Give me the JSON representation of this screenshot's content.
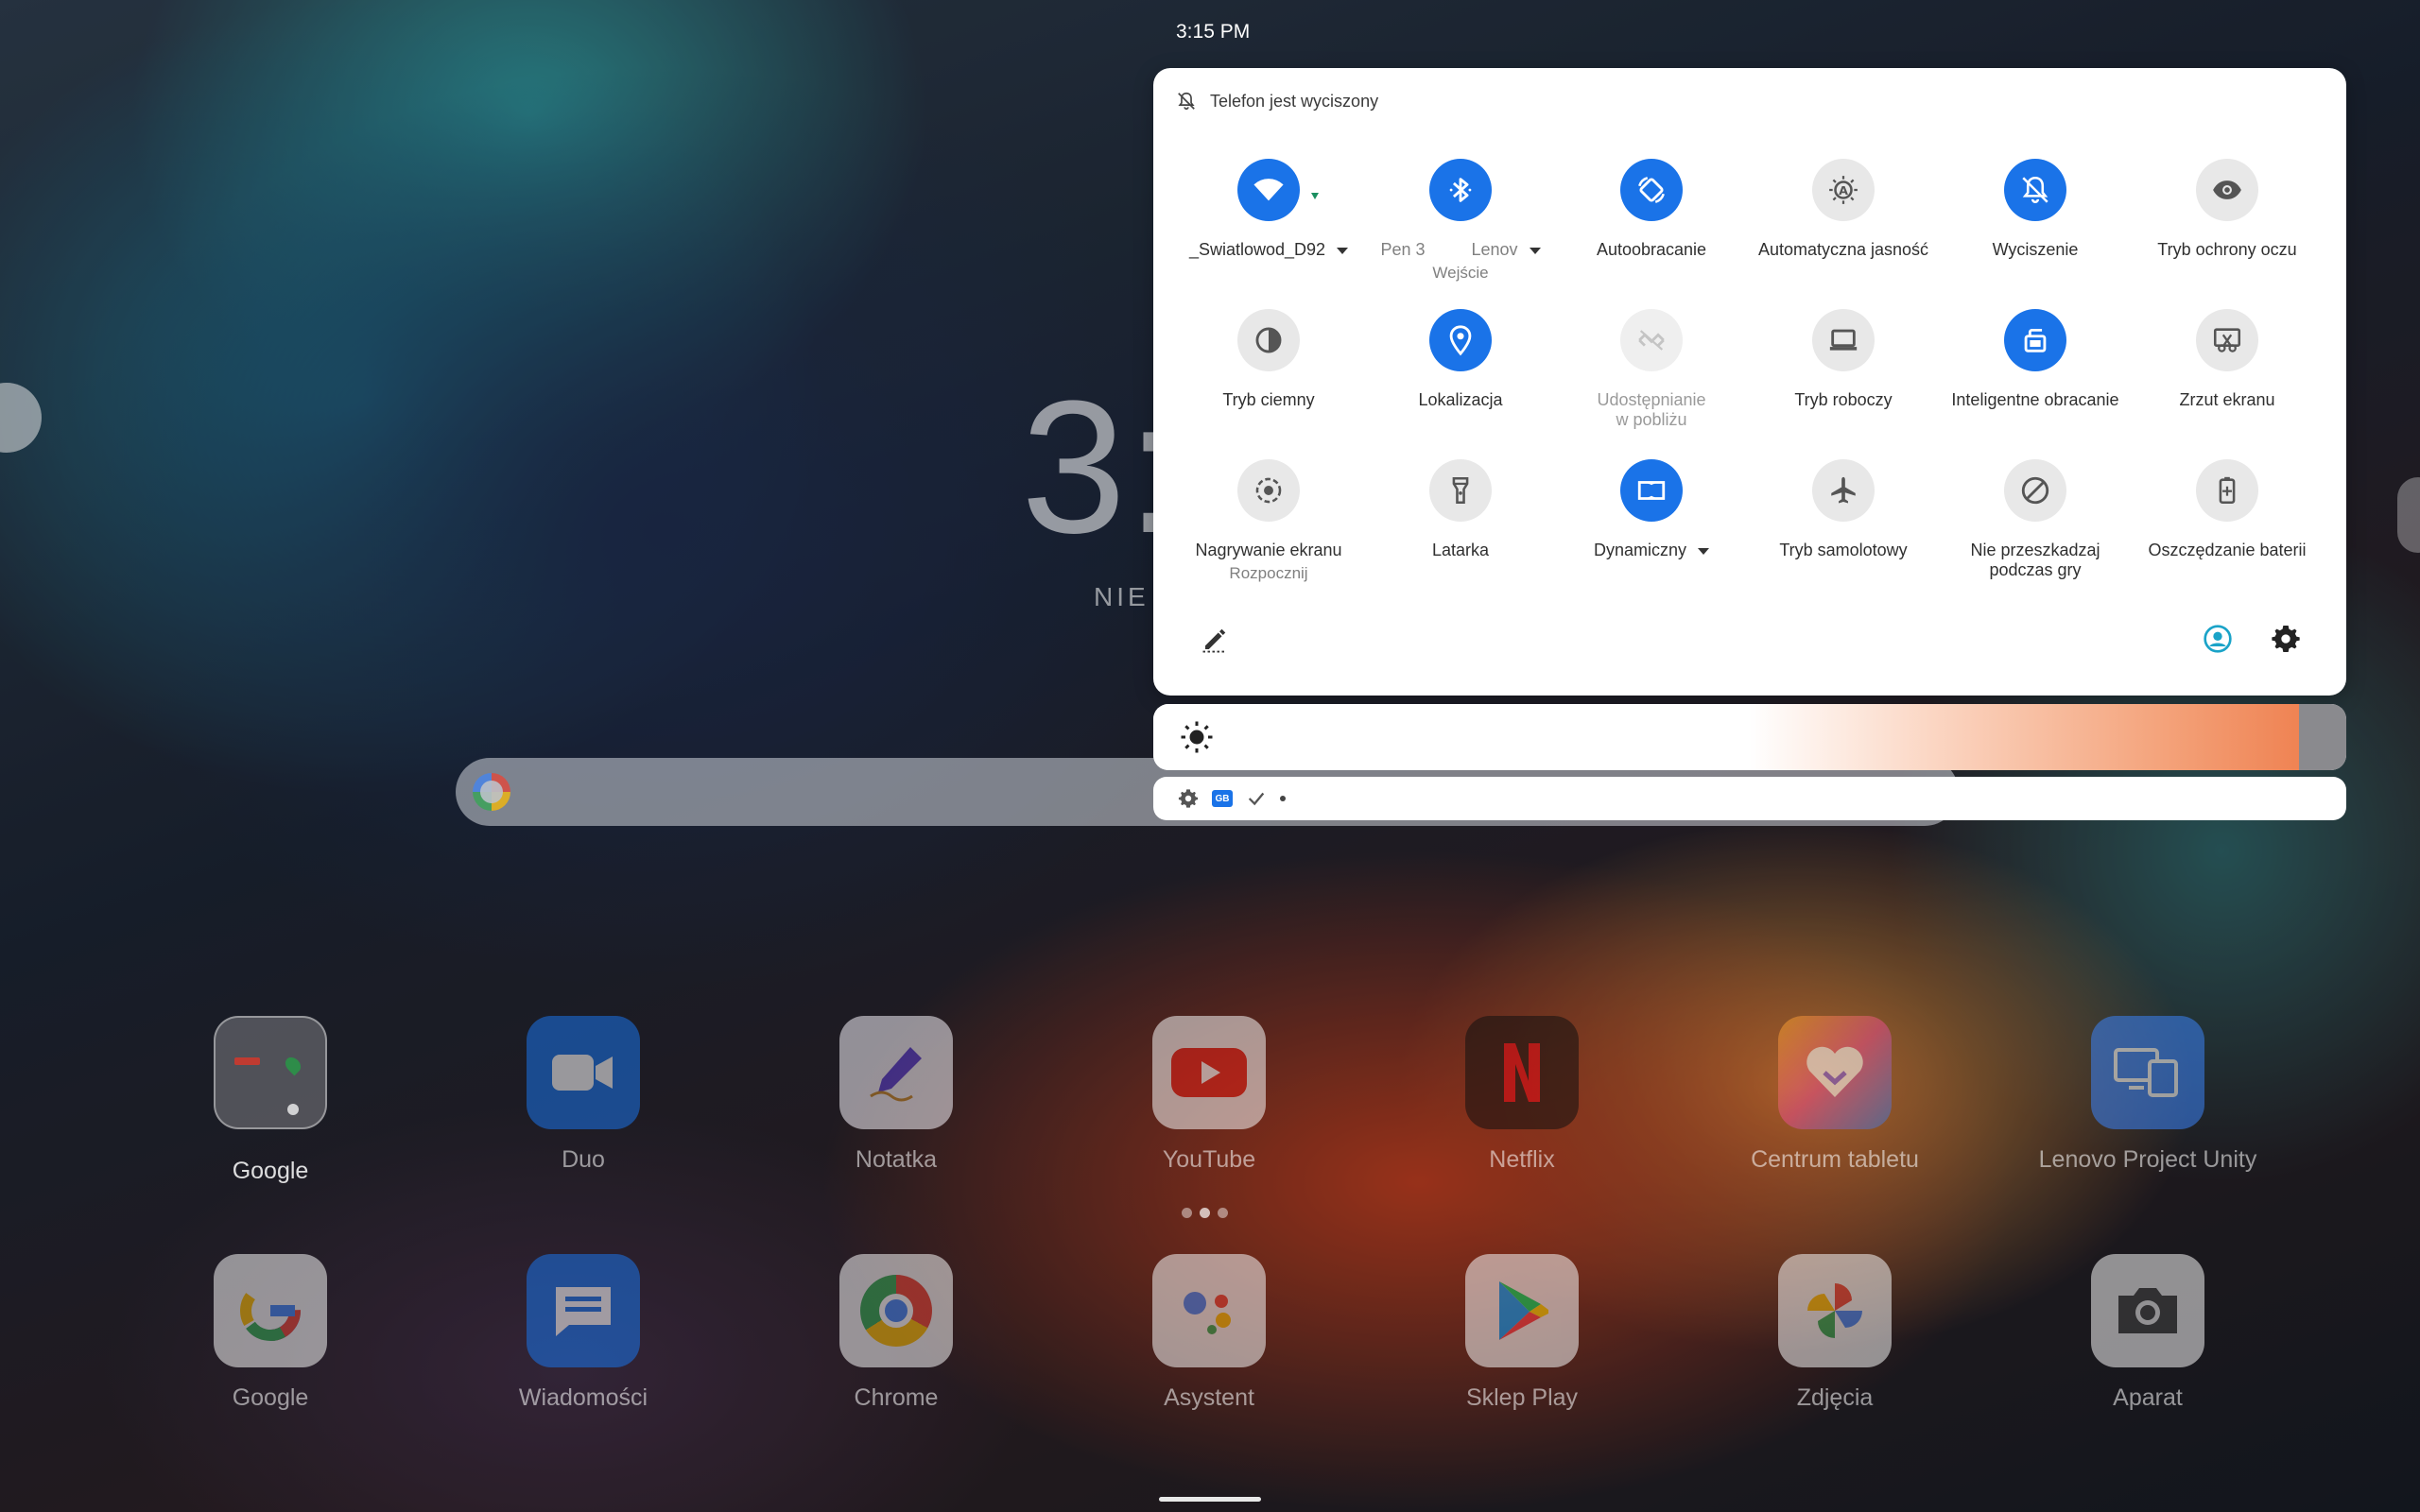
{
  "status_bar": {
    "time": "3:15 PM"
  },
  "home": {
    "clock_partial": "3:",
    "date_partial": "NIE",
    "page_indicator": {
      "pages": 3,
      "active": 1
    },
    "apps_row1": [
      {
        "label": "Google",
        "icon": "folder-icon"
      },
      {
        "label": "Duo",
        "icon": "duo-icon"
      },
      {
        "label": "Notatka",
        "icon": "note-icon"
      },
      {
        "label": "YouTube",
        "icon": "youtube-icon"
      },
      {
        "label": "Netflix",
        "icon": "netflix-icon"
      },
      {
        "label": "Centrum tabletu",
        "icon": "tablet-center-icon"
      },
      {
        "label": "Lenovo Project Unity",
        "icon": "project-unity-icon"
      }
    ],
    "apps_row2": [
      {
        "label": "Google",
        "icon": "google-icon"
      },
      {
        "label": "Wiadomości",
        "icon": "messages-icon"
      },
      {
        "label": "Chrome",
        "icon": "chrome-icon"
      },
      {
        "label": "Asystent",
        "icon": "assistant-icon"
      },
      {
        "label": "Sklep Play",
        "icon": "play-store-icon"
      },
      {
        "label": "Zdjęcia",
        "icon": "photos-icon"
      },
      {
        "label": "Aparat",
        "icon": "camera-icon"
      }
    ]
  },
  "quick_settings": {
    "header": "Telefon jest wyciszony",
    "tiles": [
      {
        "id": "wifi",
        "label": "_Swiatlowod_D92",
        "state": "on",
        "has_dropdown": true
      },
      {
        "id": "bluetooth",
        "label": "Pen 3",
        "label2": "Lenov",
        "sublabel": "Wejście",
        "state": "on",
        "has_dropdown": true
      },
      {
        "id": "autorotate",
        "label": "Autoobracanie",
        "state": "on"
      },
      {
        "id": "auto-brightness",
        "label": "Automatyczna jasność",
        "state": "off"
      },
      {
        "id": "mute",
        "label": "Wyciszenie",
        "state": "on"
      },
      {
        "id": "eye-protection",
        "label": "Tryb ochrony oczu",
        "state": "off"
      },
      {
        "id": "dark-mode",
        "label": "Tryb ciemny",
        "state": "off"
      },
      {
        "id": "location",
        "label": "Lokalizacja",
        "state": "on"
      },
      {
        "id": "nearby-share",
        "label": "Udostępnianie w pobliżu",
        "state": "disabled"
      },
      {
        "id": "work-mode",
        "label": "Tryb roboczy",
        "state": "off"
      },
      {
        "id": "smart-rotate",
        "label": "Inteligentne obracanie",
        "state": "on"
      },
      {
        "id": "screenshot",
        "label": "Zrzut ekranu",
        "state": "off"
      },
      {
        "id": "screen-record",
        "label": "Nagrywanie ekranu",
        "sublabel": "Rozpocznij",
        "state": "off"
      },
      {
        "id": "flashlight",
        "label": "Latarka",
        "state": "off"
      },
      {
        "id": "dolby",
        "label": "Dynamiczny",
        "state": "on",
        "has_dropdown": true
      },
      {
        "id": "airplane",
        "label": "Tryb samolotowy",
        "state": "off"
      },
      {
        "id": "game-dnd",
        "label": "Nie przeszkadzaj podczas gry",
        "state": "off"
      },
      {
        "id": "battery-saver",
        "label": "Oszczędzanie baterii",
        "state": "off"
      }
    ]
  },
  "brightness": {
    "level": 0.96,
    "accent": "#ef8353"
  },
  "notification_strip": {
    "badge": "GB"
  },
  "colors": {
    "active_tile": "#1a73e8",
    "inactive_tile": "#e8e8e8"
  }
}
